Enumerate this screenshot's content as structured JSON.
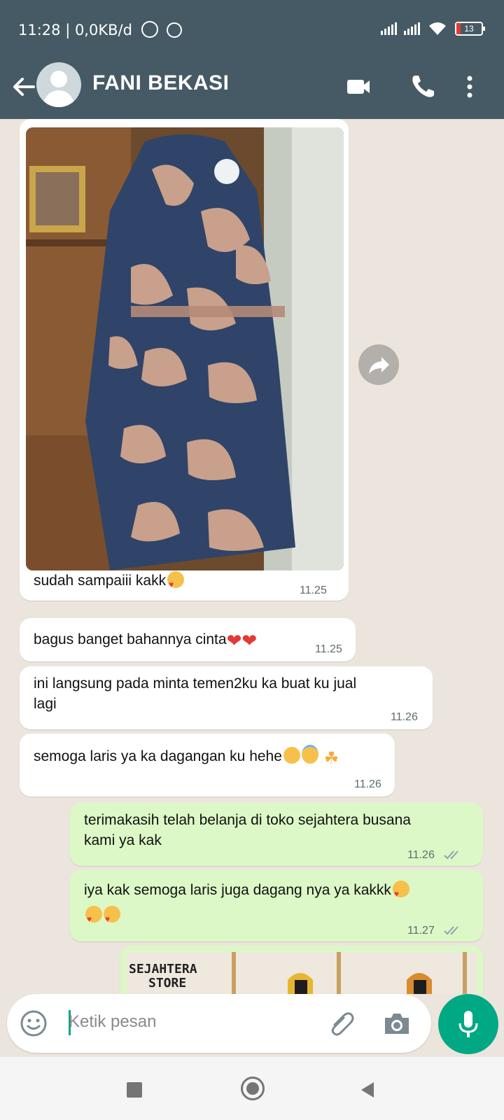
{
  "status": {
    "time": "11:28 | 0,0KB/d",
    "battery": "13"
  },
  "header": {
    "contact_name": "FANI BEKASI"
  },
  "messages": [
    {
      "text": "sudah sampaiii kakk",
      "time": "11.25"
    },
    {
      "text": "bagus banget bahannya cinta",
      "time": "11.25"
    },
    {
      "line1": "ini langsung pada minta temen2ku ka buat ku jual",
      "line2": "lagi",
      "time": "11.26"
    },
    {
      "text": "semoga laris ya ka dagangan ku hehe",
      "time": "11.26"
    },
    {
      "line1": "terimakasih telah belanja di toko sejahtera busana",
      "line2": "kami ya kak",
      "time": "11.26"
    },
    {
      "text": "iya kak semoga laris juga dagang nya ya kakkk",
      "time": "11.27"
    }
  ],
  "store_image": {
    "label_line1": "SEJAHTERA",
    "label_line2": "STORE"
  },
  "composer": {
    "placeholder": "Ketik pesan"
  },
  "colors": {
    "header": "#455a64",
    "outgoing": "#dcf8c6",
    "accent": "#00a884",
    "background": "#ece5dd"
  }
}
